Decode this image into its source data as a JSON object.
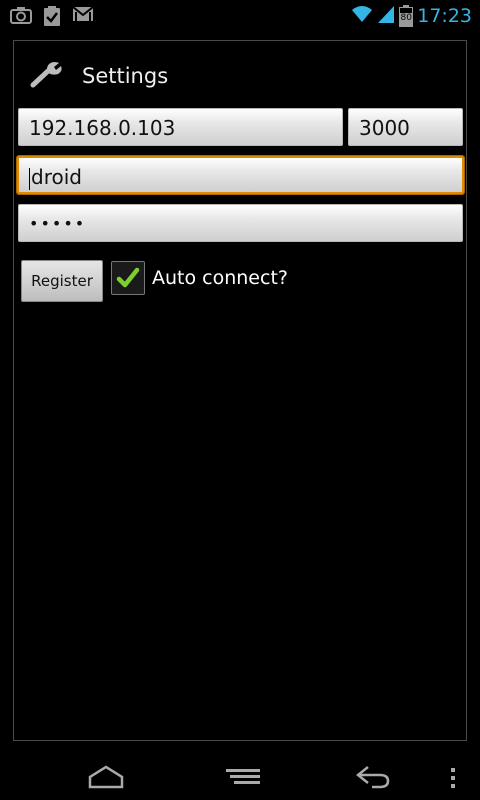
{
  "status_bar": {
    "time": "17:23",
    "battery_level": "80",
    "icons": [
      "camera-icon",
      "clipboard-check-icon",
      "gmail-icon",
      "wifi-icon",
      "signal-icon",
      "battery-icon"
    ]
  },
  "dialog": {
    "title": "Settings",
    "title_icon": "wrench-icon"
  },
  "form": {
    "host": "192.168.0.103",
    "port": "3000",
    "username": "droid",
    "password_masked": "•••••",
    "register_label": "Register",
    "auto_connect_label": "Auto connect?",
    "auto_connect_checked": true
  },
  "nav_bar": {
    "buttons": [
      "home-icon",
      "recent-apps-icon",
      "back-icon",
      "overflow-menu-icon"
    ]
  },
  "colors": {
    "accent_blue": "#33b5e5",
    "focus_orange": "#e08a00",
    "check_green": "#7ecf2b"
  }
}
